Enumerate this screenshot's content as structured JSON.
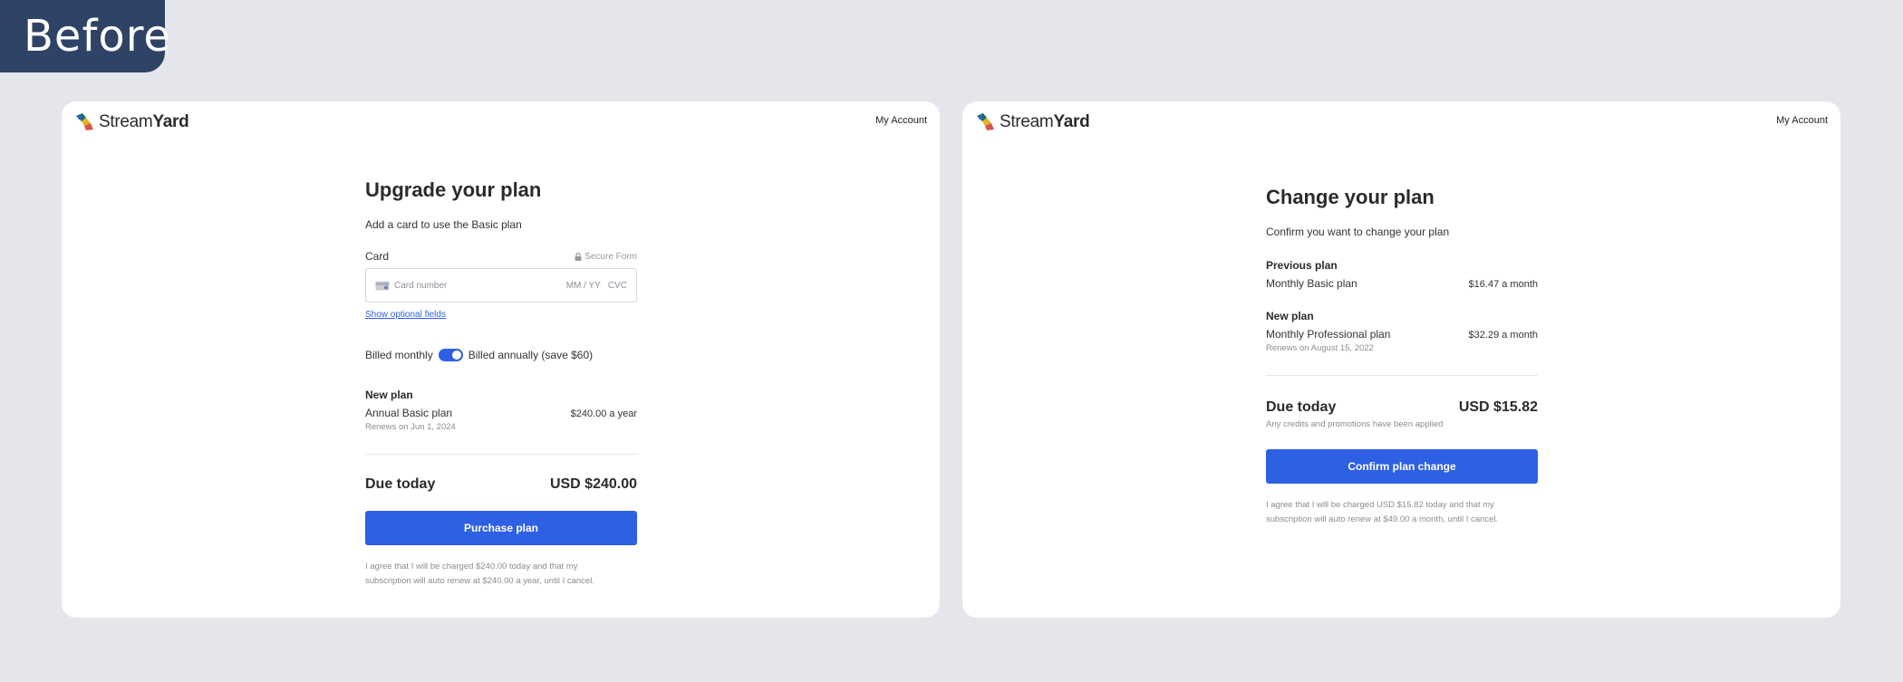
{
  "tag": {
    "label": "Before"
  },
  "left": {
    "brand": {
      "light": "Stream",
      "bold": "Yard"
    },
    "account_link": "My Account",
    "title": "Upgrade your plan",
    "subtitle": "Add a card to use the Basic plan",
    "card": {
      "label": "Card",
      "secure_label": "Secure Form",
      "number_placeholder": "Card number",
      "expiry_placeholder": "MM / YY",
      "cvc_placeholder": "CVC",
      "optional_link": "Show optional fields"
    },
    "billing": {
      "monthly_label": "Billed monthly",
      "annual_label": "Billed annually (save $60)",
      "annual_selected": true
    },
    "new_plan": {
      "heading": "New plan",
      "name": "Annual Basic plan",
      "price": "$240.00 a year",
      "renews": "Renews on Jun 1, 2024"
    },
    "due": {
      "label": "Due today",
      "amount": "USD $240.00"
    },
    "cta": "Purchase plan",
    "legal_line1": "I agree that I will be charged $240.00 today and that my",
    "legal_line2": "subscription will auto renew at $240.00 a year, until I cancel."
  },
  "right": {
    "brand": {
      "light": "Stream",
      "bold": "Yard"
    },
    "account_link": "My Account",
    "title": "Change your plan",
    "subtitle": "Confirm you want to change your plan",
    "previous_plan": {
      "heading": "Previous plan",
      "name": "Monthly Basic plan",
      "price": "$16.47 a month"
    },
    "new_plan": {
      "heading": "New plan",
      "name": "Monthly Professional plan",
      "price": "$32.29 a month",
      "renews": "Renews on August 15, 2022"
    },
    "due": {
      "label": "Due today",
      "amount": "USD $15.82",
      "note": "Any credits and promotions have been applied"
    },
    "cta": "Confirm plan change",
    "legal_line1": "I agree that I will be charged USD $15.82 today and that my",
    "legal_line2": "subscription will auto renew at $49.00 a month, until I cancel."
  },
  "colors": {
    "page_bg": "#e4e6ec",
    "tag_bg": "#2f4366",
    "accent": "#2e60e3",
    "link": "#2e5fe5"
  },
  "icons": [
    "streamyard-logo-icon",
    "lock-icon",
    "credit-card-icon"
  ]
}
